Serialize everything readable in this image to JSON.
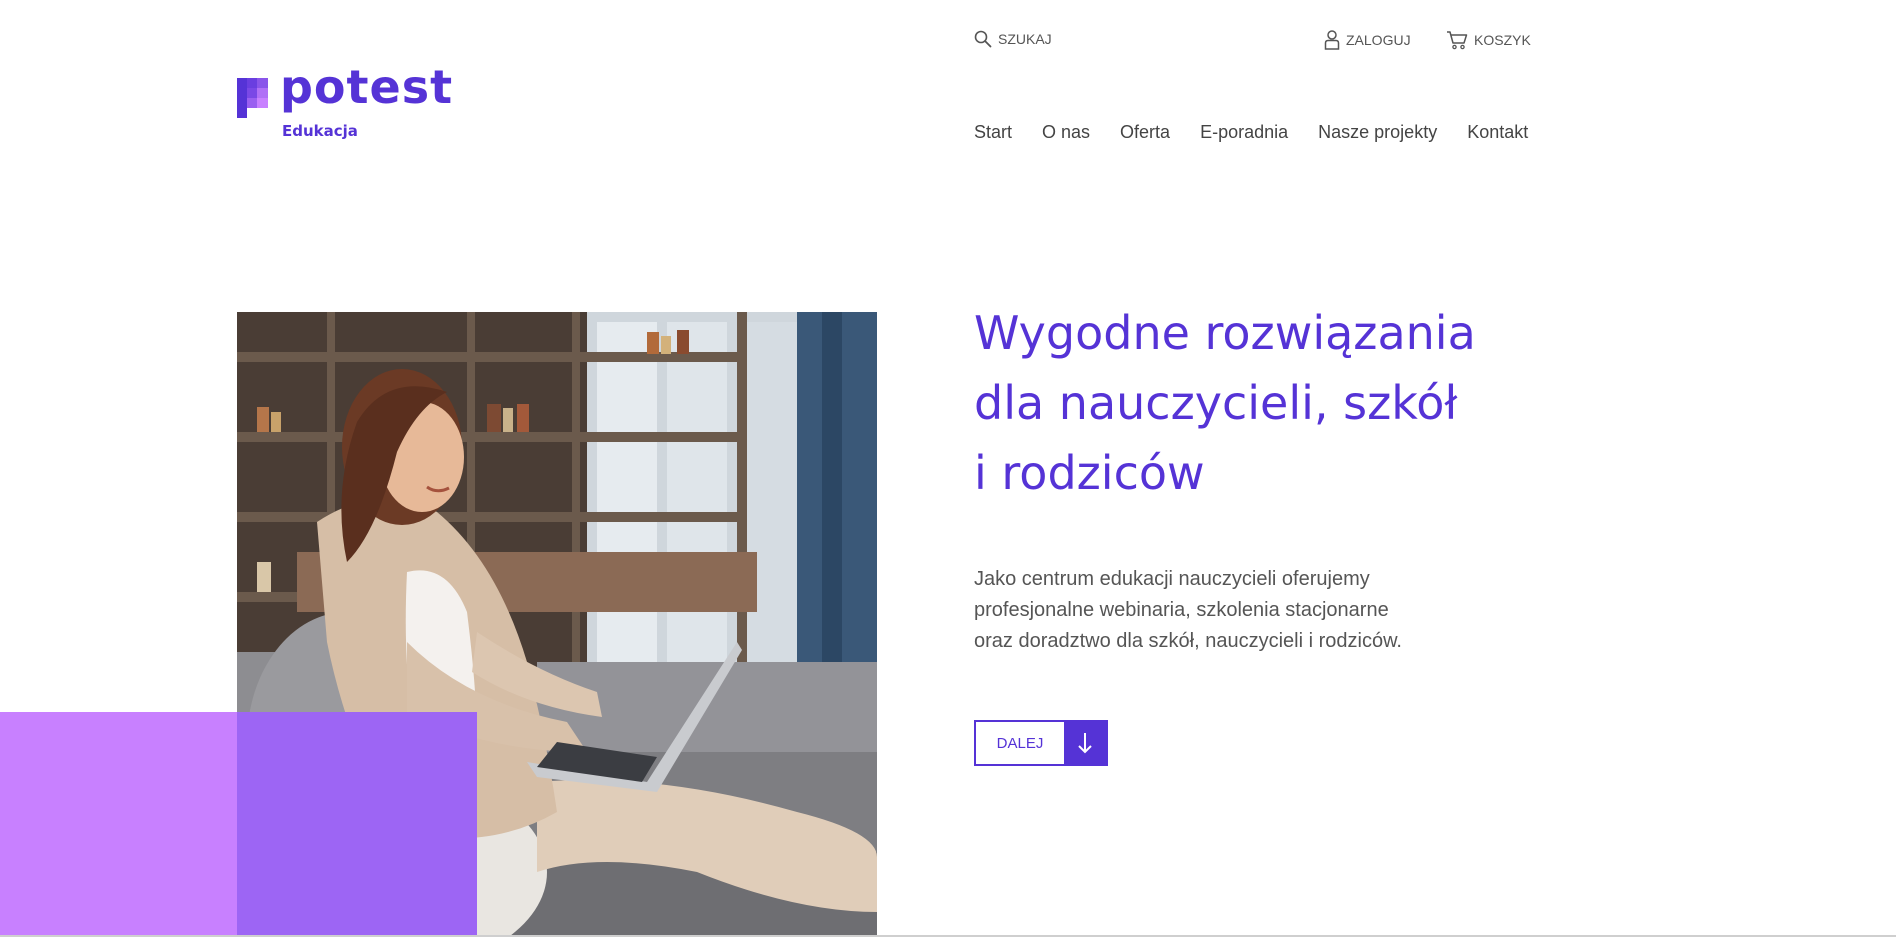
{
  "brand": {
    "name": "potest",
    "subtitle": "Edukacja",
    "color": "#5533d6",
    "accent": "#c880ff"
  },
  "header": {
    "search_label": "SZUKAJ",
    "login_label": "ZALOGUJ",
    "cart_label": "KOSZYK"
  },
  "nav": {
    "items": [
      {
        "label": "Start"
      },
      {
        "label": "O nas"
      },
      {
        "label": "Oferta"
      },
      {
        "label": "E-poradnia"
      },
      {
        "label": "Nasze projekty"
      },
      {
        "label": "Kontakt"
      }
    ]
  },
  "hero": {
    "title_lines": [
      "Wygodne rozwiązania",
      "dla nauczycieli, szkół",
      "i rodziców"
    ],
    "description_lines": [
      "Jako centrum edukacji nauczycieli oferujemy",
      "profesjonalne webinaria, szkolenia stacjonarne",
      "oraz doradztwo dla szkół, nauczycieli i rodziców."
    ],
    "cta_label": "DALEJ",
    "image": "woman-with-laptop-on-sofa"
  },
  "icons": {
    "search": "search-icon",
    "user": "user-icon",
    "cart": "cart-icon",
    "arrow": "arrow-down-icon"
  }
}
